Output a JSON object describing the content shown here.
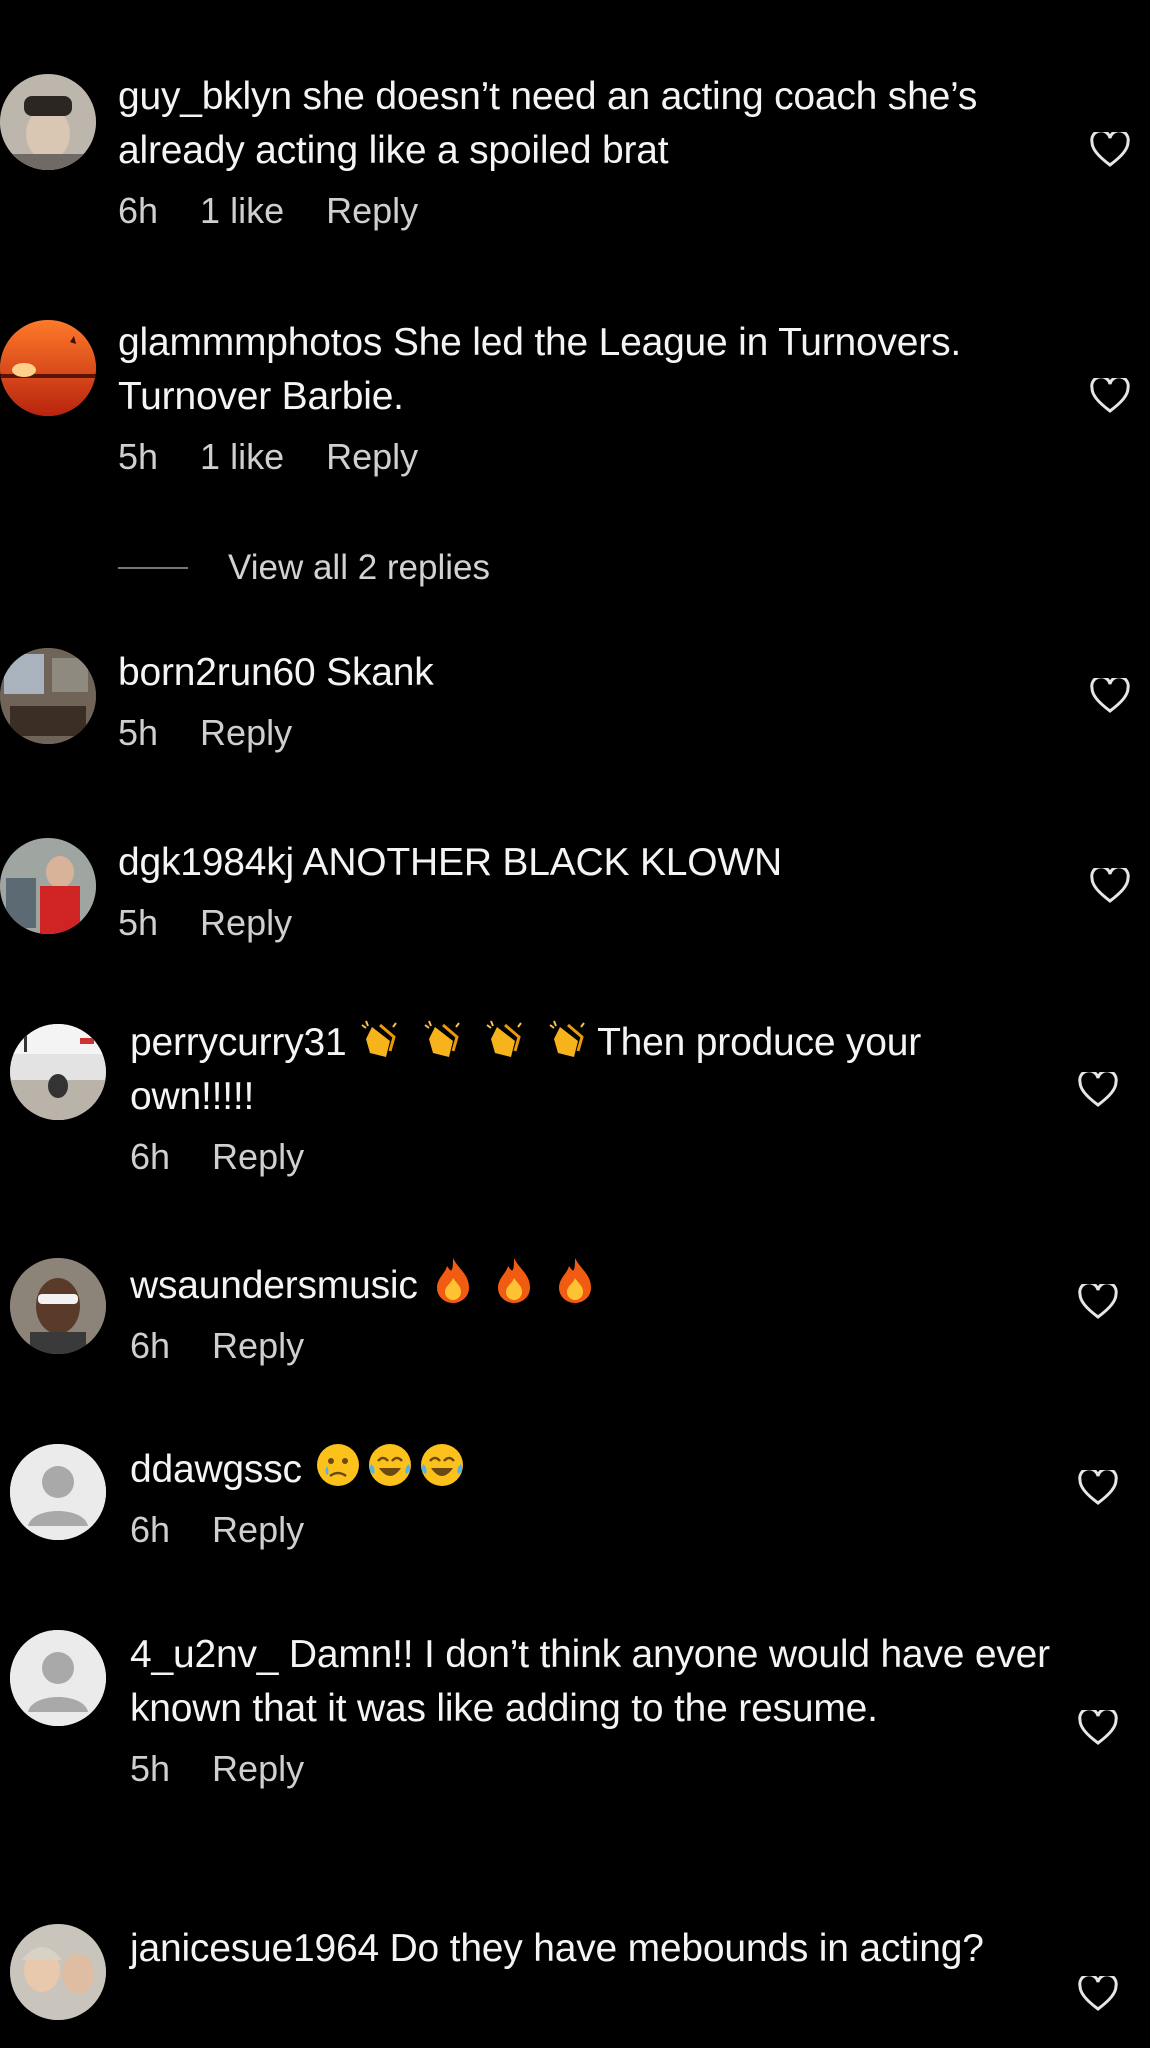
{
  "comments": [
    {
      "user": "guy_bklyn",
      "text": "she doesn’t need an acting coach she’s already acting like a spoiled brat",
      "time": "6h",
      "likes": "1 like",
      "reply": "Reply"
    },
    {
      "user": "glammmphotos",
      "text": "She led the League in Turnovers. Turnover Barbie.",
      "time": "5h",
      "likes": "1 like",
      "reply": "Reply"
    },
    {
      "user": "born2run60",
      "text": "Skank",
      "time": "5h",
      "reply": "Reply"
    },
    {
      "user": "dgk1984kj",
      "text": "ANOTHER BLACK KLOWN",
      "time": "5h",
      "reply": "Reply"
    },
    {
      "user": "perrycurry31",
      "emojis": [
        "clap",
        "clap",
        "clap",
        "clap"
      ],
      "text": "Then produce your own!!!!!",
      "time": "6h",
      "reply": "Reply"
    },
    {
      "user": "wsaundersmusic",
      "emojis": [
        "fire",
        "fire",
        "fire"
      ],
      "time": "6h",
      "reply": "Reply"
    },
    {
      "user": "ddawgssc",
      "emojis": [
        "crying-face",
        "tears-of-joy",
        "tears-of-joy"
      ],
      "time": "6h",
      "reply": "Reply"
    },
    {
      "user": "4_u2nv_",
      "text": "Damn!! I don’t think anyone would have ever known that it was like adding to the resume.",
      "time": "5h",
      "reply": "Reply"
    },
    {
      "user": "janicesue1964",
      "text": "Do they have mebounds in acting?"
    }
  ],
  "view_replies": "View all 2 replies",
  "icons": {
    "like": "heart-outline-icon",
    "default_avatar": "default-avatar-icon"
  }
}
